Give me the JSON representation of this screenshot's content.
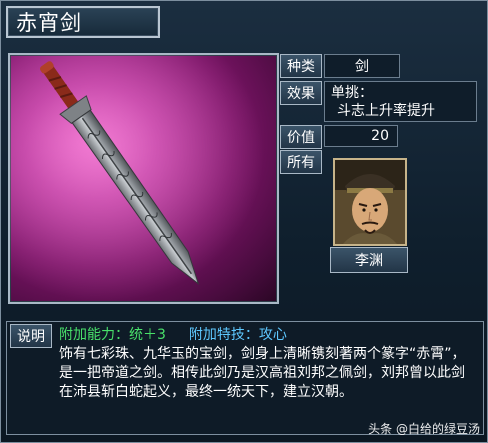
{
  "item": {
    "title": "赤宵剑",
    "fields": {
      "type_label": "种类",
      "type_value": "剑",
      "effect_label": "效果",
      "effect_line1": "单挑：",
      "effect_line2": "斗志上升率提升",
      "value_label": "价值",
      "value_value": "20",
      "owner_label": "所有",
      "owner_name": "李渊"
    },
    "description": {
      "label": "说明",
      "ability_text": "附加能力：统＋3",
      "special_text": "附加特技：攻心",
      "body": "饰有七彩珠、九华玉的宝剑，剑身上清晰镌刻著两个篆字“赤霄”，是一把帝道之剑。相传此剑乃是汉高祖刘邦之佩剑，刘邦曾以此剑在沛县斩白蛇起义，最终一统天下，建立汉朝。"
    }
  },
  "watermark": "头条 @白给的绿豆汤",
  "colors": {
    "background": "#0d1a26",
    "label_bg": "#2e465a",
    "ability_green": "#48e06a",
    "special_cyan": "#5ec8ff",
    "image_bg": "#b02f95"
  },
  "icons": {
    "sword": "sword-image",
    "portrait": "general-portrait"
  }
}
